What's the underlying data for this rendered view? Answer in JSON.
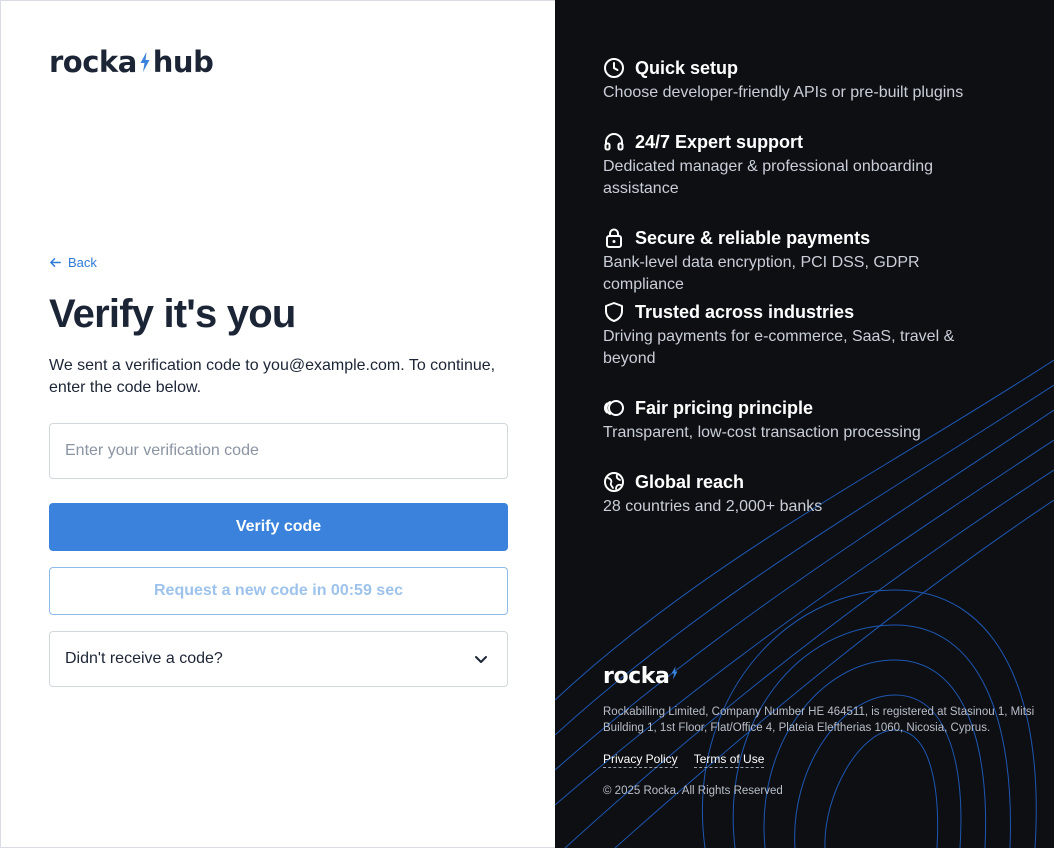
{
  "brand": {
    "logo_left": "rocka",
    "logo_right": "hub",
    "footer_logo": "rocka",
    "accent_color": "#3a82db",
    "bolt_color": "#3a82db"
  },
  "auth": {
    "back_label": "Back",
    "title": "Verify it's you",
    "description": "We sent a verification code to you@example.com. To continue, enter the code below.",
    "code_input": {
      "placeholder": "Enter your verification code",
      "value": ""
    },
    "verify_button": "Verify code",
    "resend_button": "Request a new code in 00:59 sec",
    "help_accordion": "Didn't receive a code?"
  },
  "features": [
    {
      "icon": "clock-icon",
      "title": "Quick setup",
      "text": "Choose developer-friendly APIs or pre-built plugins"
    },
    {
      "icon": "headset-icon",
      "title": "24/7 Expert support",
      "text": "Dedicated manager & professional onboarding assistance"
    },
    {
      "icon": "lock-icon",
      "title": "Secure & reliable payments",
      "text": "Bank-level data encryption, PCI DSS, GDPR compliance"
    },
    {
      "icon": "shield-icon",
      "title": "Trusted across industries",
      "text": "Driving payments for e-commerce, SaaS, travel & beyond"
    },
    {
      "icon": "coins-icon",
      "title": "Fair pricing principle",
      "text": "Transparent, low-cost transaction processing"
    },
    {
      "icon": "globe-icon",
      "title": "Global reach",
      "text": "28 countries and 2,000+ banks"
    }
  ],
  "footer": {
    "legal": "Rockabilling Limited, Company Number HE 464511, is registered at Stasinou 1, Mitsi Building 1, 1st Floor, Flat/Office 4, Plateia Eleftherias 1060, Nicosia, Cyprus.",
    "privacy_link": "Privacy Policy",
    "terms_link": "Terms of Use",
    "copyright": "© 2025 Rocka. All Rights Reserved"
  }
}
